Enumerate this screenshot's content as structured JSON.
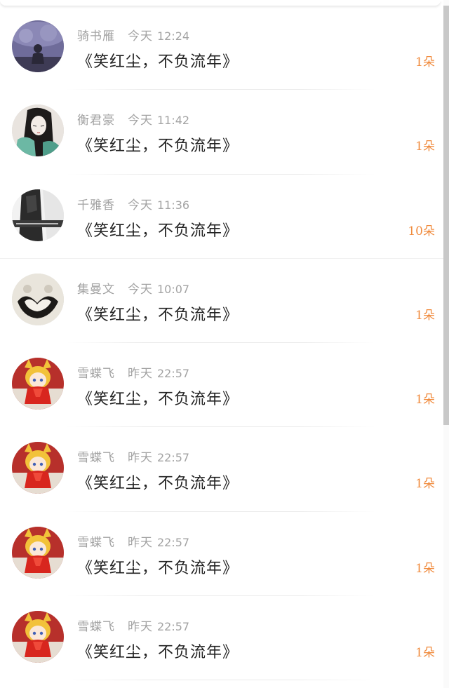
{
  "items": [
    {
      "name": "骑书雁",
      "day": "今天",
      "time": "12:24",
      "message": "《笑红尘，不负流年》",
      "count": "1朵",
      "avatar": "avatar-night-figure"
    },
    {
      "name": "衡君豪",
      "day": "今天",
      "time": "11:42",
      "message": "《笑红尘，不负流年》",
      "count": "1朵",
      "avatar": "avatar-longhair-girl"
    },
    {
      "name": "千雅香",
      "day": "今天",
      "time": "11:36",
      "message": "《笑红尘，不负流年》",
      "count": "10朵",
      "avatar": "avatar-monochrome-photo"
    },
    {
      "name": "集曼文",
      "day": "今天",
      "time": "10:07",
      "message": "《笑红尘，不负流年》",
      "count": "1朵",
      "avatar": "avatar-heart-cats"
    },
    {
      "name": "雪蝶飞",
      "day": "昨天",
      "time": "22:57",
      "message": "《笑红尘，不负流年》",
      "count": "1朵",
      "avatar": "avatar-anime-fox-girl"
    },
    {
      "name": "雪蝶飞",
      "day": "昨天",
      "time": "22:57",
      "message": "《笑红尘，不负流年》",
      "count": "1朵",
      "avatar": "avatar-anime-fox-girl"
    },
    {
      "name": "雪蝶飞",
      "day": "昨天",
      "time": "22:57",
      "message": "《笑红尘，不负流年》",
      "count": "1朵",
      "avatar": "avatar-anime-fox-girl"
    },
    {
      "name": "雪蝶飞",
      "day": "昨天",
      "time": "22:57",
      "message": "《笑红尘，不负流年》",
      "count": "1朵",
      "avatar": "avatar-anime-fox-girl"
    }
  ],
  "colors": {
    "count": "#f08a3c",
    "meta": "#a3a3a3",
    "message": "#222222"
  }
}
